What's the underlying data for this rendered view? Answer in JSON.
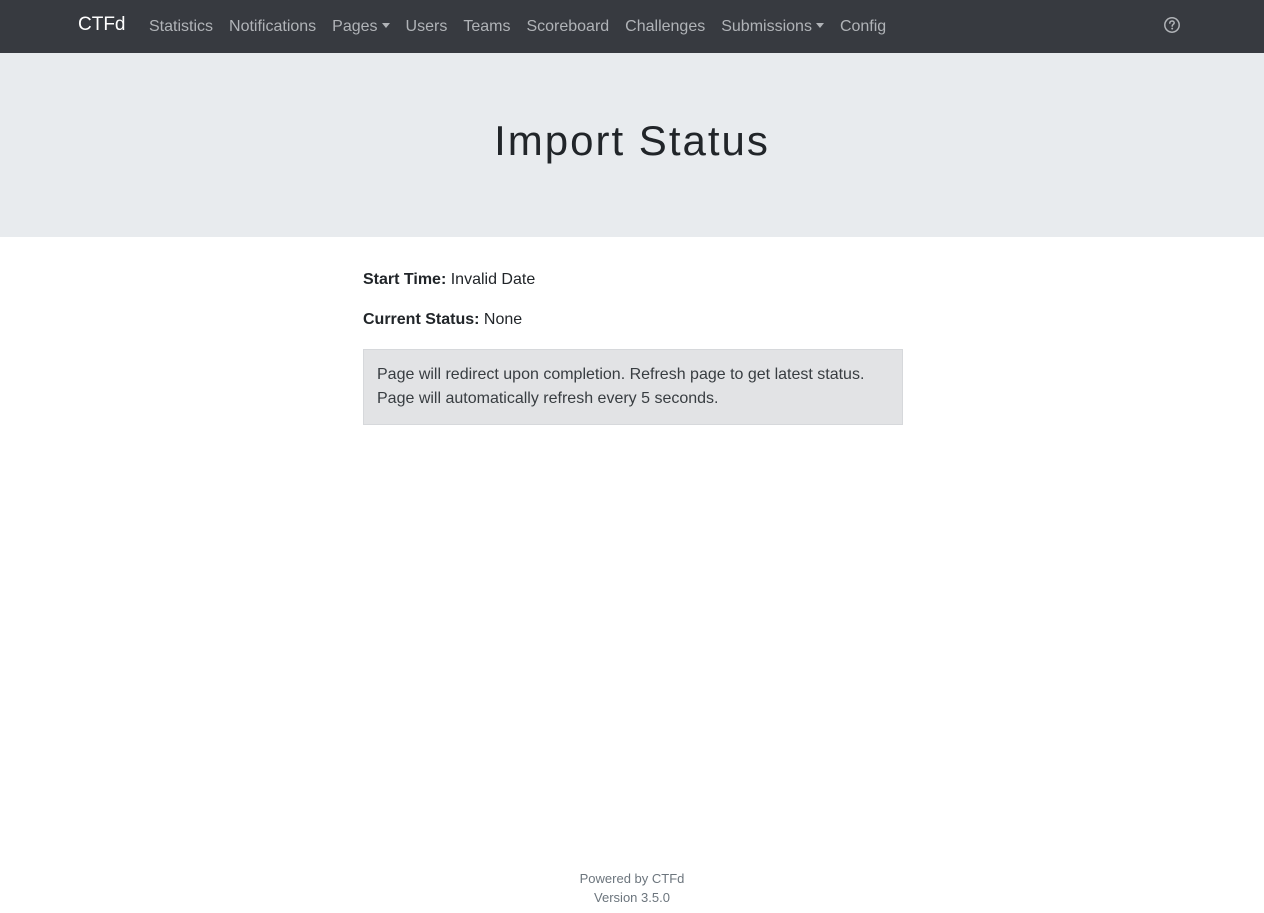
{
  "navbar": {
    "brand": "CTFd",
    "items": [
      {
        "label": "Statistics"
      },
      {
        "label": "Notifications"
      },
      {
        "label": "Pages",
        "dropdown": true
      },
      {
        "label": "Users"
      },
      {
        "label": "Teams"
      },
      {
        "label": "Scoreboard"
      },
      {
        "label": "Challenges"
      },
      {
        "label": "Submissions",
        "dropdown": true
      },
      {
        "label": "Config"
      }
    ],
    "help_icon": "question-circle-icon"
  },
  "header": {
    "title": "Import Status"
  },
  "status": {
    "start_time_label": "Start Time:",
    "start_time_value": "Invalid Date",
    "current_status_label": "Current Status:",
    "current_status_value": "None"
  },
  "alert": {
    "line1": "Page will redirect upon completion. Refresh page to get latest status.",
    "line2": "Page will automatically refresh every 5 seconds."
  },
  "footer": {
    "powered_by": "Powered by CTFd",
    "version": "Version 3.5.0"
  },
  "colors": {
    "navbar_bg": "#373a40",
    "jumbotron_bg": "#e8ebee",
    "alert_bg": "#e2e3e5"
  }
}
